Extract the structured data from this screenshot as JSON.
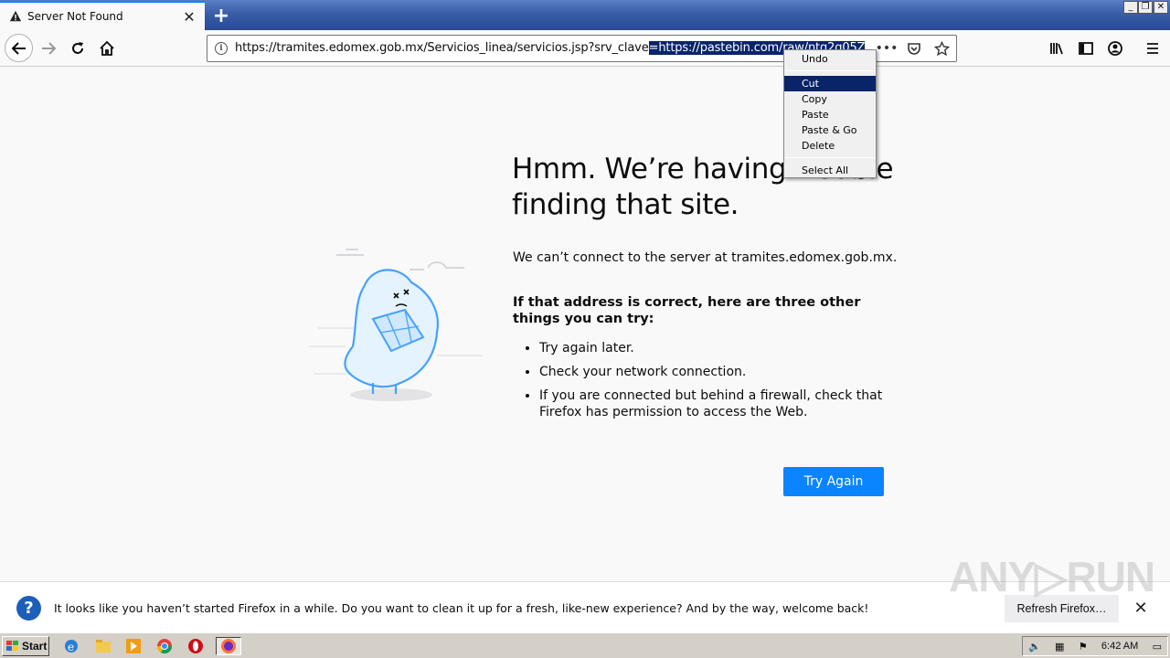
{
  "tab": {
    "title": "Server Not Found",
    "close_glyph": "✕"
  },
  "newtab_glyph": "+",
  "window_controls": [
    "_",
    "❐",
    "✕"
  ],
  "urlbar": {
    "url_prefix": "https://tramites.edomex.gob.mx/Servicios_linea/servicios.jsp?srv_clave",
    "url_selected": "=https://pastebin.com/raw/ntq2q05Z",
    "info_glyph": "i",
    "more_glyph": "•••"
  },
  "error_page": {
    "headline": "Hmm. We’re having trouble finding that site.",
    "description": "We can’t connect to the server at tramites.edomex.gob.mx.",
    "subheading": "If that address is correct, here are three other things you can try:",
    "tips": [
      "Try again later.",
      "Check your network connection.",
      "If you are connected but behind a firewall, check that Firefox has permission to access the Web."
    ],
    "try_again_label": "Try Again"
  },
  "context_menu": {
    "items": [
      {
        "label": "Undo"
      },
      {
        "label": "Cut"
      },
      {
        "label": "Copy"
      },
      {
        "label": "Paste"
      },
      {
        "label": "Paste & Go"
      },
      {
        "label": "Delete"
      },
      {
        "label": "Select All"
      }
    ],
    "highlighted": "Cut"
  },
  "notification": {
    "icon_glyph": "?",
    "message": "It looks like you haven’t started Firefox in a while. Do you want to clean it up for a fresh, like-new experience? And by the way, welcome back!",
    "button_label": "Refresh Firefox…",
    "close_glyph": "✕"
  },
  "watermark": "ANY▷RUN",
  "taskbar": {
    "start_label": "Start",
    "clock": "6:42 AM",
    "icons": [
      "ie-icon",
      "explorer-icon",
      "media-player-icon",
      "chrome-icon",
      "opera-icon",
      "firefox-icon"
    ]
  },
  "colors": {
    "accent": "#0a84ff",
    "selection": "#0a246a",
    "tabstrip": "#3a5da8"
  }
}
